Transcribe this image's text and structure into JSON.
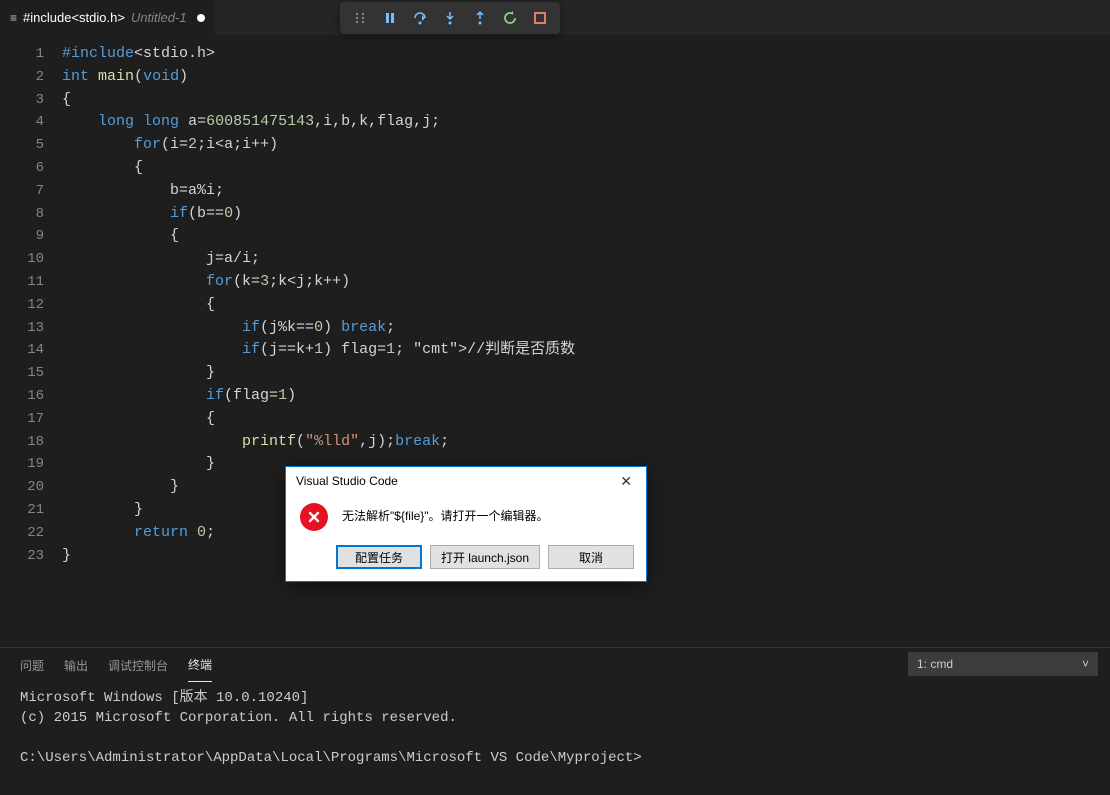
{
  "tab": {
    "title": "#include<stdio.h>",
    "subtitle": "Untitled-1"
  },
  "debug_toolbar": {
    "buttons": [
      "grip",
      "pause",
      "step-over",
      "step-into",
      "step-out",
      "restart",
      "stop"
    ]
  },
  "code": {
    "lines": [
      "#include<stdio.h>",
      "int main(void)",
      "{",
      "    long long a=600851475143,i,b,k,flag,j;",
      "        for(i=2;i<a;i++)",
      "        {",
      "            b=a%i;",
      "            if(b==0)",
      "            {",
      "                j=a/i;",
      "                for(k=3;k<j;k++)",
      "                {",
      "                    if(j%k==0) break;",
      "                    if(j==k+1) flag=1; //判断是否质数",
      "                }",
      "                if(flag=1)",
      "                {",
      "                    printf(\"%lld\",j);break;",
      "                }",
      "            }",
      "        }",
      "        return 0;",
      "}"
    ]
  },
  "panel": {
    "tabs": [
      "问题",
      "输出",
      "调试控制台",
      "终端"
    ],
    "active_tab": 3,
    "terminal_selector": "1: cmd",
    "terminal_lines": [
      "Microsoft Windows [版本 10.0.10240]",
      "(c) 2015 Microsoft Corporation. All rights reserved.",
      "",
      "C:\\Users\\Administrator\\AppData\\Local\\Programs\\Microsoft VS Code\\Myproject>"
    ]
  },
  "dialog": {
    "title": "Visual Studio Code",
    "message": "无法解析\"${file}\"。请打开一个编辑器。",
    "buttons": {
      "configure": "配置任务",
      "open_launch": "打开 launch.json",
      "cancel": "取消"
    }
  }
}
